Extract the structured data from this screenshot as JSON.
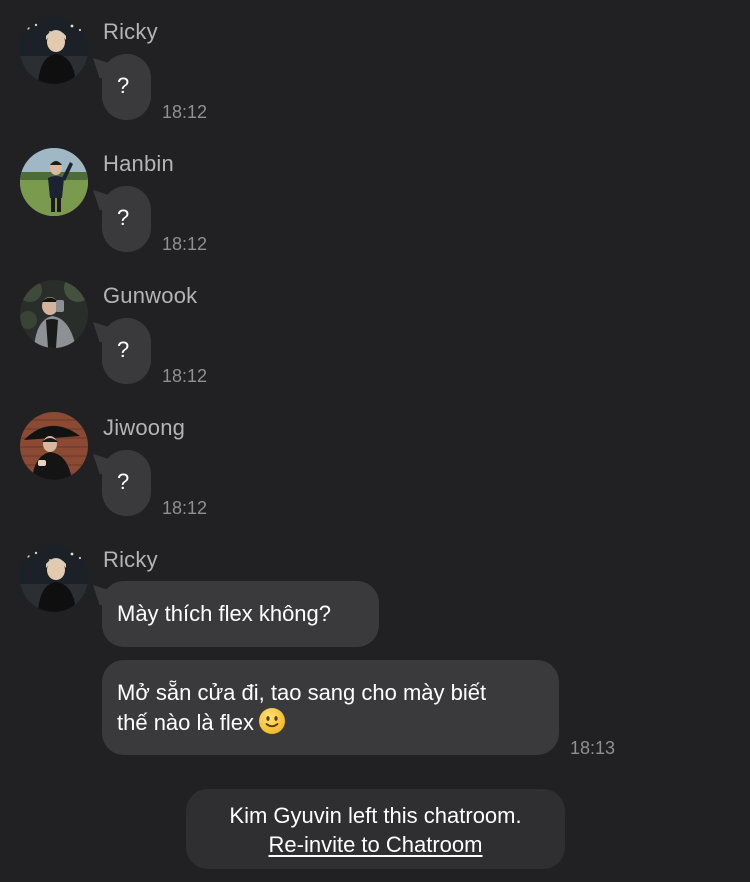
{
  "messages": [
    {
      "sender": "Ricky",
      "text": "?",
      "time": "18:12",
      "avatar": "ricky-avatar"
    },
    {
      "sender": "Hanbin",
      "text": "?",
      "time": "18:12",
      "avatar": "hanbin-avatar"
    },
    {
      "sender": "Gunwook",
      "text": "?",
      "time": "18:12",
      "avatar": "gunwook-avatar"
    },
    {
      "sender": "Jiwoong",
      "text": "?",
      "time": "18:12",
      "avatar": "jiwoong-avatar"
    }
  ],
  "last_group": {
    "sender": "Ricky",
    "bubble1": "Mày thích flex không?",
    "bubble2_line1": "Mở sẵn cửa đi, tao sang cho mày biết",
    "bubble2_line2": "thế nào là flex",
    "emoji": "slightly-smiling-face-icon",
    "time": "18:13"
  },
  "system_notice": {
    "text": "Kim Gyuvin left this chatroom.",
    "link": "Re-invite to Chatroom"
  },
  "colors": {
    "background": "#212123",
    "bubble": "#3a3a3c",
    "sender_name": "#b4b4b8",
    "timestamp": "#8f8f94"
  }
}
